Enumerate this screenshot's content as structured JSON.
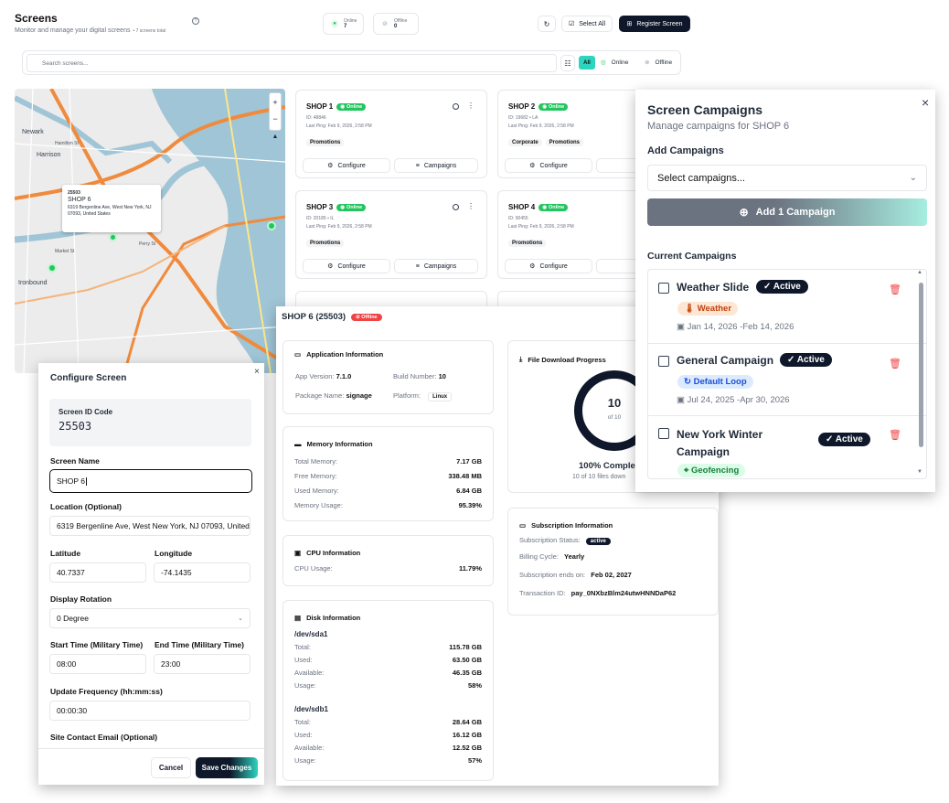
{
  "header": {
    "title": "Screens",
    "subtitle": "Monitor and manage your digital screens",
    "count": "• 7 screens total",
    "online_label": "Online",
    "online_count": "7",
    "offline_label": "Offline",
    "offline_count": "0",
    "select_all": "Select All",
    "register": "Register Screen"
  },
  "search": {
    "placeholder": "Search screens...",
    "filter_all": "All",
    "filter_online": "Online",
    "filter_offline": "Offline"
  },
  "map": {
    "popup_id": "25503",
    "popup_name": "SHOP 6",
    "popup_address": "6319 Bergenline Ave, West New York, NJ 07093, United States",
    "labels": [
      "Newark",
      "Harrison",
      "Ironbound",
      "Hamilton St",
      "Perry St",
      "Market St"
    ]
  },
  "screens": [
    {
      "name": "SHOP 1",
      "status": "Online",
      "id": "ID: 48846",
      "ping": "Last Ping: Feb 9, 2026, 2:58 PM",
      "tags": [
        "Promotions"
      ]
    },
    {
      "name": "SHOP 2",
      "status": "Online",
      "id": "ID: 19682 • LA",
      "ping": "Last Ping: Feb 9, 2026, 2:58 PM",
      "tags": [
        "Corporate",
        "Promotions"
      ]
    },
    {
      "name": "SHOP 3",
      "status": "Online",
      "id": "ID: 20185 • IL",
      "ping": "Last Ping: Feb 9, 2026, 2:58 PM",
      "tags": [
        "Promotions"
      ]
    },
    {
      "name": "SHOP 4",
      "status": "Online",
      "id": "ID: 90455",
      "ping": "Last Ping: Feb 9, 2026, 2:58 PM",
      "tags": [
        "Promotions"
      ]
    }
  ],
  "card_actions": {
    "configure": "Configure",
    "campaigns": "Campaigns"
  },
  "configure": {
    "title": "Configure Screen",
    "id_label": "Screen ID Code",
    "id_value": "25503",
    "name_label": "Screen Name",
    "name_value": "SHOP 6",
    "loc_label": "Location (Optional)",
    "loc_value": "6319 Bergenline Ave, West New York, NJ 07093, United S",
    "lat_label": "Latitude",
    "lat_value": "40.7337",
    "lng_label": "Longitude",
    "lng_value": "-74.1435",
    "rot_label": "Display Rotation",
    "rot_value": "0 Degree",
    "start_label": "Start Time (Military Time)",
    "start_value": "08:00",
    "end_label": "End Time (Military Time)",
    "end_value": "23:00",
    "freq_label": "Update Frequency (hh:mm:ss)",
    "freq_value": "00:00:30",
    "email_label": "Site Contact Email (Optional)",
    "cancel": "Cancel",
    "save": "Save Changes"
  },
  "detail": {
    "title": "SHOP 6 (25503)",
    "status": "Offline",
    "app": {
      "title": "Application Information",
      "version_label": "App Version:",
      "version": "7.1.0",
      "build_label": "Build Number:",
      "build": "10",
      "package_label": "Package Name:",
      "package": "signage",
      "platform_label": "Platform:",
      "platform": "Linux"
    },
    "memory": {
      "title": "Memory Information",
      "rows": [
        {
          "k": "Total Memory:",
          "v": "7.17 GB"
        },
        {
          "k": "Free Memory:",
          "v": "338.48 MB"
        },
        {
          "k": "Used Memory:",
          "v": "6.84 GB"
        },
        {
          "k": "Memory Usage:",
          "v": "95.39%"
        }
      ]
    },
    "cpu": {
      "title": "CPU Information",
      "k": "CPU Usage:",
      "v": "11.79%"
    },
    "disk": {
      "title": "Disk Information",
      "disks": [
        {
          "name": "/dev/sda1",
          "rows": [
            {
              "k": "Total:",
              "v": "115.78 GB"
            },
            {
              "k": "Used:",
              "v": "63.50 GB"
            },
            {
              "k": "Available:",
              "v": "46.35 GB"
            },
            {
              "k": "Usage:",
              "v": "58%"
            }
          ]
        },
        {
          "name": "/dev/sdb1",
          "rows": [
            {
              "k": "Total:",
              "v": "28.64 GB"
            },
            {
              "k": "Used:",
              "v": "16.12 GB"
            },
            {
              "k": "Available:",
              "v": "12.52 GB"
            },
            {
              "k": "Usage:",
              "v": "57%"
            }
          ]
        }
      ]
    },
    "download": {
      "title": "File Download Progress",
      "count": "10",
      "of": "of 10",
      "pct": "100% Comple",
      "files": "10 of 10 files down",
      "progress": 1.0
    },
    "subscription": {
      "title": "Subscription Information",
      "status_label": "Subscription Status:",
      "status": "active",
      "cycle_label": "Billing Cycle:",
      "cycle": "Yearly",
      "ends_label": "Subscription ends on:",
      "ends": "Feb 02, 2027",
      "txn_label": "Transaction ID:",
      "txn": "pay_0NXbzBlm24utwHNNDaP62"
    }
  },
  "campaigns": {
    "title": "Screen Campaigns",
    "subtitle": "Manage campaigns for SHOP 6",
    "add_label": "Add Campaigns",
    "select_placeholder": "Select campaigns...",
    "add_button": "Add 1 Campaign",
    "current_label": "Current Campaigns",
    "items": [
      {
        "name": "Weather Slide",
        "status": "Active",
        "tag": "Weather",
        "dates": "Jan 14, 2026 -Feb 14, 2026"
      },
      {
        "name": "General Campaign",
        "status": "Active",
        "tag": "Default Loop",
        "dates": "Jul 24, 2025 -Apr 30, 2026"
      },
      {
        "name": "New York Winter",
        "name2": "Campaign",
        "status": "Active",
        "tag": "Geofencing"
      }
    ]
  },
  "colors": {
    "accent": "#0f172a",
    "teal": "#2dd4bf",
    "online": "#22c55e",
    "offline": "#ef4444",
    "map_water": "#9fc5d6",
    "map_land": "#ececec",
    "road": "#f08a3c"
  }
}
